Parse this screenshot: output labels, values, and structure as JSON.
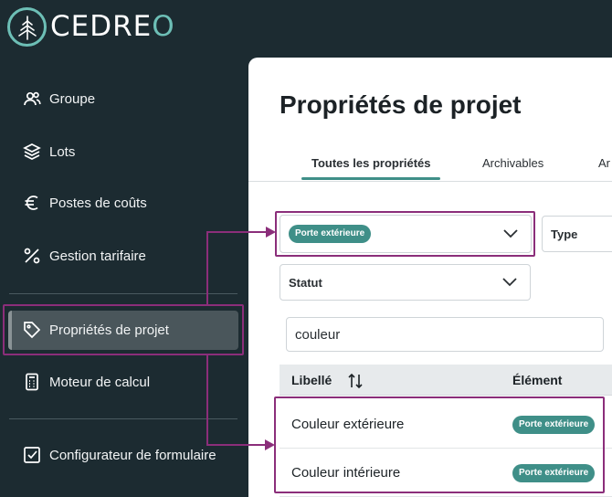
{
  "brand": {
    "name_prefix": "CEDRE",
    "name_suffix": "O"
  },
  "sidebar": {
    "items": [
      {
        "label": "Groupe",
        "icon": "users-icon"
      },
      {
        "label": "Lots",
        "icon": "layers-icon"
      },
      {
        "label": "Postes de coûts",
        "icon": "euro-icon"
      },
      {
        "label": "Gestion tarifaire",
        "icon": "percent-icon"
      },
      {
        "label": "Propriétés de projet",
        "icon": "tag-icon",
        "active": true
      },
      {
        "label": "Moteur de calcul",
        "icon": "calculator-icon"
      },
      {
        "label": "Configurateur de formulaire",
        "icon": "checkbox-icon"
      }
    ]
  },
  "main": {
    "title": "Propriétés de projet",
    "tabs": [
      {
        "label": "Toutes les propriétés",
        "active": true
      },
      {
        "label": "Archivables"
      },
      {
        "label": "Ar"
      }
    ],
    "filters": {
      "element_badge": "Porte extérieure",
      "type_label": "Type",
      "status_label": "Statut"
    },
    "search": {
      "value": "couleur"
    },
    "table": {
      "columns": [
        "Libellé",
        "Élément"
      ],
      "rows": [
        {
          "label": "Couleur extérieure",
          "element": "Porte extérieure"
        },
        {
          "label": "Couleur intérieure",
          "element": "Porte extérieure"
        }
      ]
    }
  },
  "colors": {
    "accent": "#3f8f88",
    "highlight": "#8b2e7a",
    "sidebar_bg": "#1c2b31"
  }
}
